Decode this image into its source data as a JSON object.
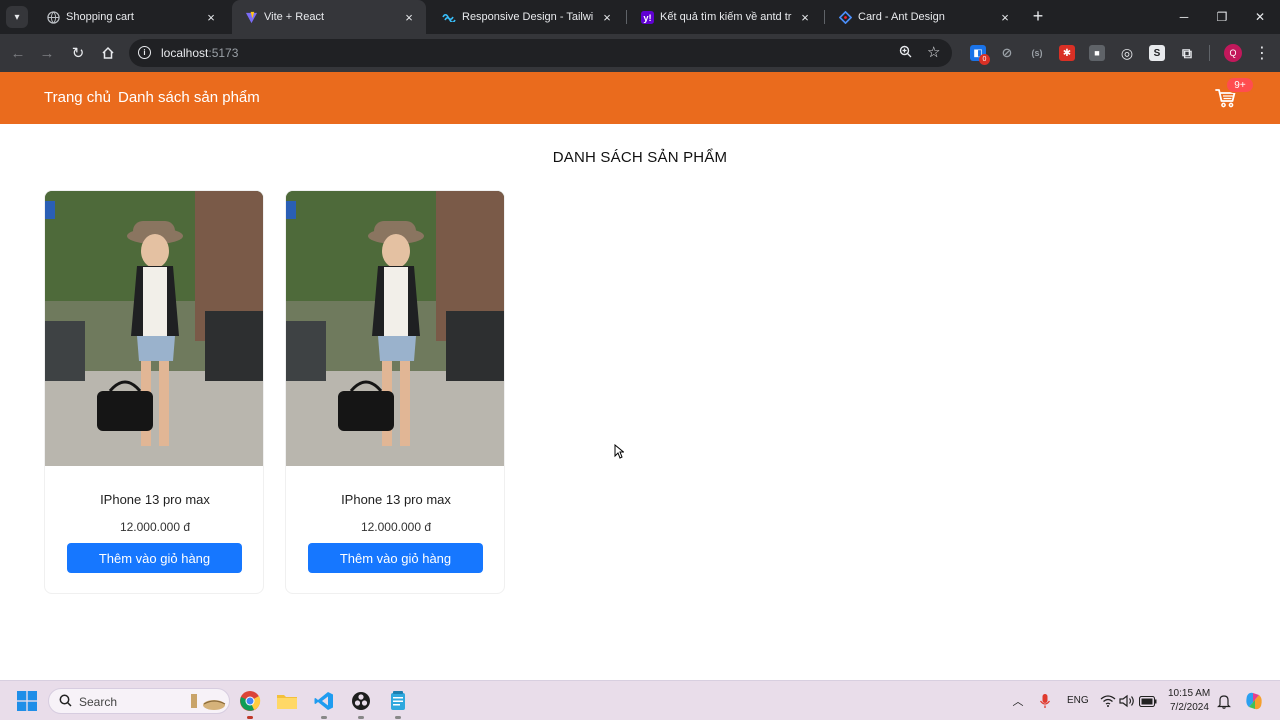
{
  "browser": {
    "tabs": [
      {
        "label": "Shopping cart",
        "icon": "globe-icon",
        "active": false
      },
      {
        "label": "Vite + React",
        "icon": "vite-icon",
        "active": true
      },
      {
        "label": "Responsive Design - Tailwind C",
        "icon": "tailwind-icon",
        "active": false
      },
      {
        "label": "Kết quả tìm kiếm về antd trên Y",
        "icon": "yahoo-icon",
        "active": false
      },
      {
        "label": "Card - Ant Design",
        "icon": "antd-icon",
        "active": false
      }
    ],
    "url_host": "localhost",
    "url_port": ":5173",
    "extension_badge": "0",
    "profile_initial": "Q"
  },
  "app": {
    "nav": {
      "home": "Trang chủ",
      "products": "Danh sách sản phẩm"
    },
    "cart_badge": "9+",
    "page_title": "DANH SÁCH SẢN PHẨM",
    "products": [
      {
        "name": "IPhone 13 pro max",
        "price": "12.000.000 đ",
        "button": "Thêm vào giỏ hàng"
      },
      {
        "name": "IPhone 13 pro max",
        "price": "12.000.000 đ",
        "button": "Thêm vào giỏ hàng"
      }
    ]
  },
  "taskbar": {
    "search_placeholder": "Search",
    "language": "ENG",
    "time": "10:15 AM",
    "date": "7/2/2024"
  },
  "colors": {
    "header_orange": "#ea6b1d",
    "button_blue": "#1677ff",
    "badge_red": "#ff4d4f"
  }
}
